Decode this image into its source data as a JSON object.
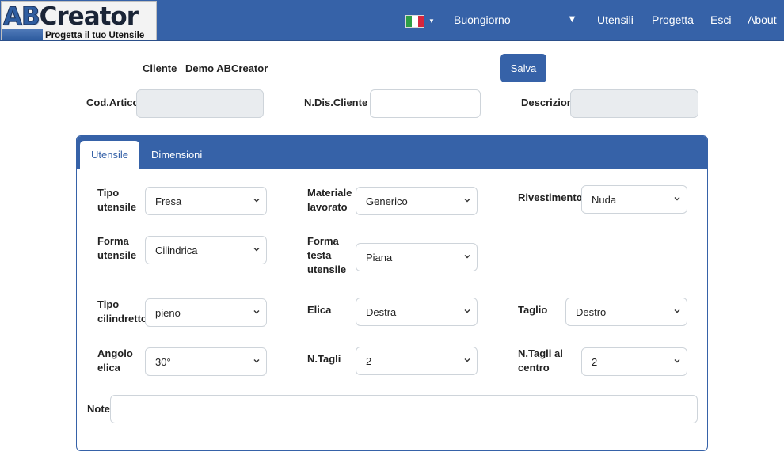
{
  "logo": {
    "brand_ab": "AB",
    "brand_rest": "Creator",
    "tagline": "Progetta il tuo Utensile"
  },
  "nav": {
    "language_icon": "italian-flag-icon",
    "greeting": "Buongiorno",
    "user_menu_arrow": "▼",
    "links": [
      "Utensili",
      "Progetta",
      "Esci",
      "About"
    ]
  },
  "header": {
    "cliente_label": "Cliente",
    "cliente_value": "Demo ABCreator",
    "save_label": "Salva",
    "cod_articolo_label": "Cod.Articolo",
    "cod_articolo_value": "",
    "n_dis_cliente_label": "N.Dis.Cliente",
    "n_dis_cliente_value": "",
    "descrizione_label": "Descrizione",
    "descrizione_value": ""
  },
  "tabs": {
    "active": "Utensile",
    "other": "Dimensioni"
  },
  "form": {
    "tipo_utensile": {
      "label_1": "Tipo",
      "label_2": "utensile",
      "value": "Fresa"
    },
    "materiale_lavorato": {
      "label_1": "Materiale",
      "label_2": "lavorato",
      "value": "Generico"
    },
    "rivestimento": {
      "label": "Rivestimento",
      "value": "Nuda"
    },
    "forma_utensile": {
      "label_1": "Forma",
      "label_2": "utensile",
      "value": "Cilindrica"
    },
    "forma_testa": {
      "label_1": "Forma",
      "label_2": "testa",
      "label_3": "utensile",
      "value": "Piana"
    },
    "tipo_cilindretto": {
      "label_1": "Tipo",
      "label_2": "cilindretto",
      "value": "pieno"
    },
    "elica": {
      "label": "Elica",
      "value": "Destra"
    },
    "taglio": {
      "label": "Taglio",
      "value": "Destro"
    },
    "angolo_elica": {
      "label_1": "Angolo",
      "label_2": "elica",
      "value": "30°"
    },
    "n_tagli": {
      "label": "N.Tagli",
      "value": "2"
    },
    "n_tagli_centro": {
      "label_1": "N.Tagli al",
      "label_2": "centro",
      "value": "2"
    },
    "note": {
      "label": "Note",
      "value": ""
    }
  },
  "colors": {
    "primary": "#3662a8",
    "readonly_bg": "#e9ecef",
    "border": "#ced4da"
  }
}
